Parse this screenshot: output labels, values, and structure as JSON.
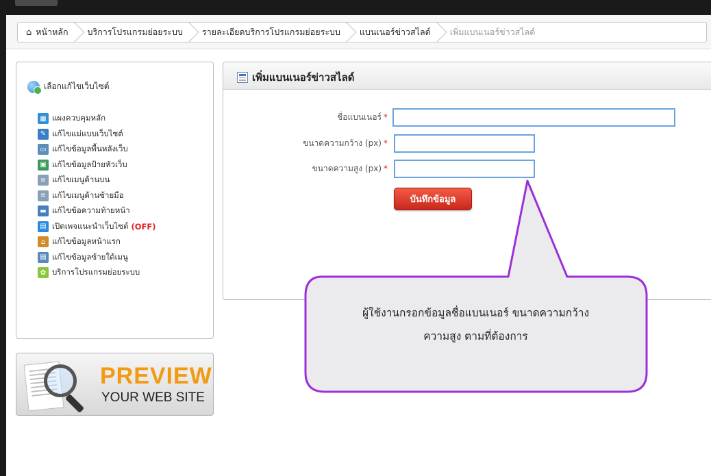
{
  "breadcrumb": {
    "home": "หน้าหลัก",
    "level1": "บริการโปรแกรมย่อยระบบ",
    "level2": "รายละเอียดบริการโปรแกรมย่อยระบบ",
    "level3": "แบนเนอร์ข่าวสไลด์",
    "current": "เพิ่มแบนเนอร์ข่าวสไลด์"
  },
  "sidebar": {
    "header": "เลือกแก้ไขเว็บไซต์",
    "items": [
      {
        "label": "แผงควบคุมหลัก",
        "icon": "dashboard-icon",
        "color": "#2f8fd8"
      },
      {
        "label": "แก้ไขแม่แบบเว็บไซต์",
        "icon": "template-icon",
        "color": "#3a7ec8"
      },
      {
        "label": "แก้ไขข้อมูลพื้นหลังเว็บ",
        "icon": "background-icon",
        "color": "#5a8fb8"
      },
      {
        "label": "แก้ไขข้อมูลป้ายหัวเว็บ",
        "icon": "header-banner-icon",
        "color": "#3c9a5a"
      },
      {
        "label": "แก้ไขเมนูด้านบน",
        "icon": "top-menu-icon",
        "color": "#8aa0b8"
      },
      {
        "label": "แก้ไขเมนูด้านซ้ายมือ",
        "icon": "left-menu-icon",
        "color": "#8aa0b8"
      },
      {
        "label": "แก้ไขข้อความท้ายหน้า",
        "icon": "footer-icon",
        "color": "#4a7ec0"
      },
      {
        "label": "เปิดเพจแนะนำเว็บไซต์",
        "icon": "intro-page-icon",
        "color": "#2a8ae0",
        "suffix": "(OFF)"
      },
      {
        "label": "แก้ไขข้อมูลหน้าแรก",
        "icon": "home-icon",
        "color": "#d08a2a"
      },
      {
        "label": "แก้ไขข้อมูลซ้ายใต้เมนู",
        "icon": "under-menu-icon",
        "color": "#5a8ab8"
      },
      {
        "label": "บริการโปรแกรมย่อยระบบ",
        "icon": "plugin-service-icon",
        "color": "#8cc63f"
      }
    ]
  },
  "preview": {
    "title": "PREVIEW",
    "subtitle": "YOUR WEB SITE"
  },
  "main": {
    "title": "เพิ่มแบนเนอร์ข่าวสไลด์",
    "fields": {
      "name_label": "ชื่อแบนเนอร์",
      "width_label": "ขนาดความกว้าง (px)",
      "height_label": "ขนาดความสูง (px)",
      "required_mark": "*",
      "name_value": "",
      "width_value": "",
      "height_value": ""
    },
    "save_label": "บันทึกข้อมูล"
  },
  "callout": {
    "line1": "ผู้ใช้งานกรอกข้อมูลชื่อแบนเนอร์ ขนาดความกว้าง",
    "line2": "ความสูง ตามที่ต้องการ",
    "border_color": "#9b30d9"
  }
}
